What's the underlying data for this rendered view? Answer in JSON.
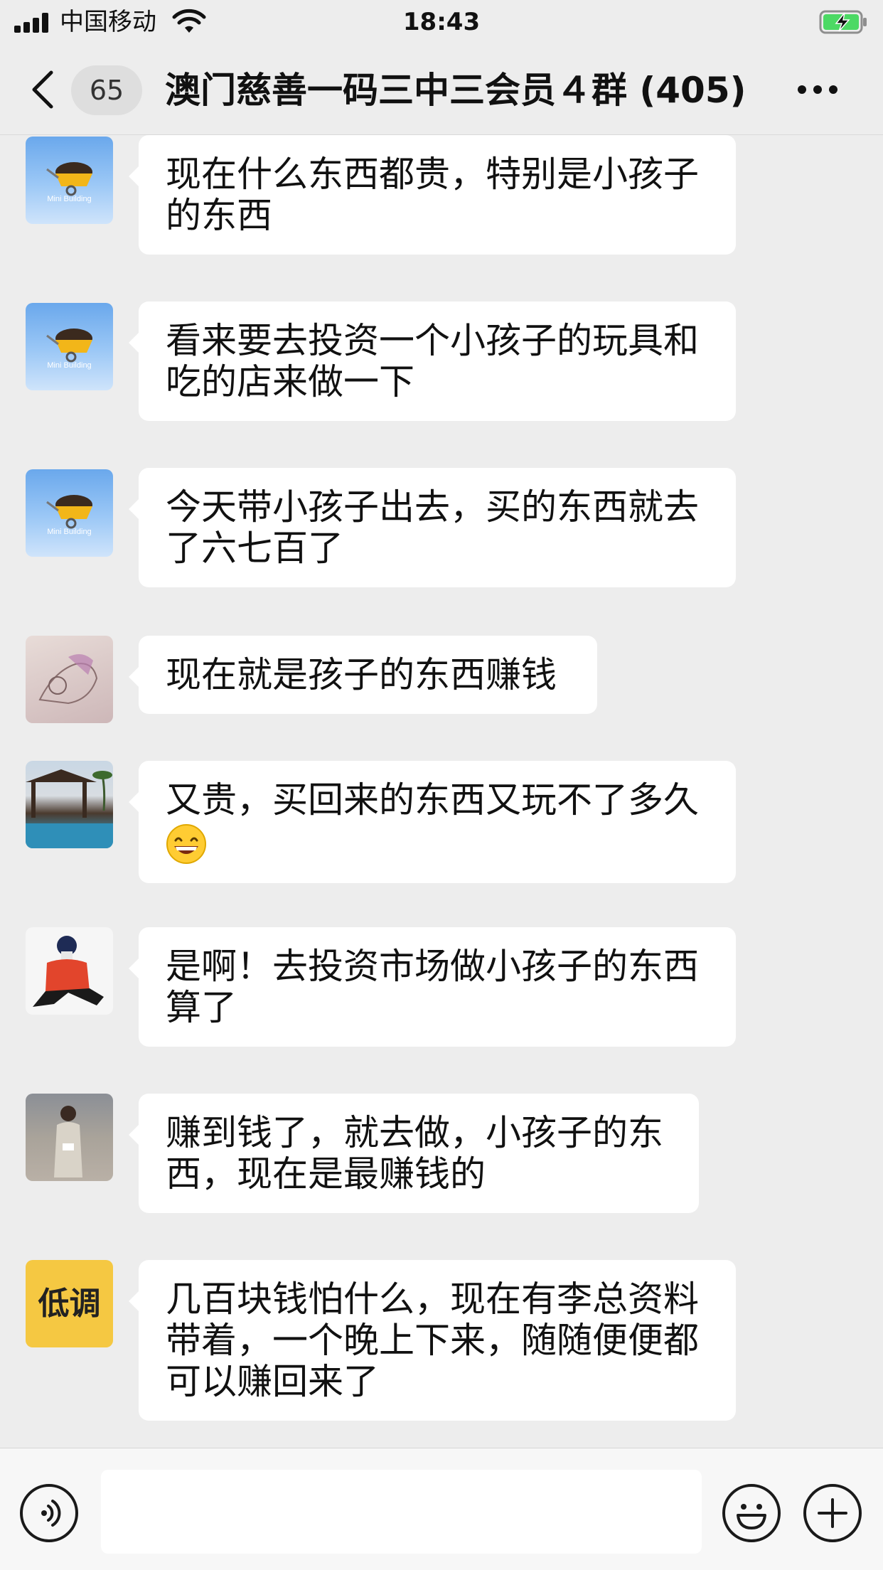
{
  "status_bar": {
    "carrier": "中国移动",
    "time": "18:43",
    "icons": [
      "signal-icon",
      "wifi-icon",
      "battery-charging-icon"
    ]
  },
  "nav": {
    "unread_count": "65",
    "title": "澳门慈善一码三中三会员４群 (405)",
    "icons": [
      "back-chevron-icon",
      "more-dots-icon"
    ]
  },
  "messages": [
    {
      "avatar": "avatar-mini-building",
      "avatar_text": "Mini Building",
      "text": "现在什么东西都贵，特别是小孩子的东西"
    },
    {
      "avatar": "avatar-mini-building",
      "avatar_text": "Mini Building",
      "text": "看来要去投资一个小孩子的玩具和吃的店来做一下"
    },
    {
      "avatar": "avatar-mini-building",
      "avatar_text": "Mini Building",
      "text": "今天带小孩子出去，买的东西就去了六七百了"
    },
    {
      "avatar": "avatar-sketch",
      "text": "现在就是孩子的东西赚钱"
    },
    {
      "avatar": "avatar-pavilion",
      "text": "又贵，买回来的东西又玩不了多久",
      "emoji": "grinning-emoji"
    },
    {
      "avatar": "avatar-person-red-jacket",
      "text": "是啊！去投资市场做小孩子的东西算了"
    },
    {
      "avatar": "avatar-lady",
      "text": "赚到钱了，就去做，小孩子的东西，现在是最赚钱的"
    },
    {
      "avatar": "avatar-text",
      "avatar_text": "低调",
      "text": "几百块钱怕什么，现在有李总资料带着，一个晚上下来，随随便便都可以赚回来了"
    }
  ],
  "input_bar": {
    "placeholder": "",
    "icons": [
      "voice-icon",
      "emoji-icon",
      "plus-icon"
    ]
  },
  "colors": {
    "background": "#ededed",
    "bubble": "#ffffff",
    "battery_green": "#4cd964",
    "avatar_yellow": "#f5c842"
  }
}
